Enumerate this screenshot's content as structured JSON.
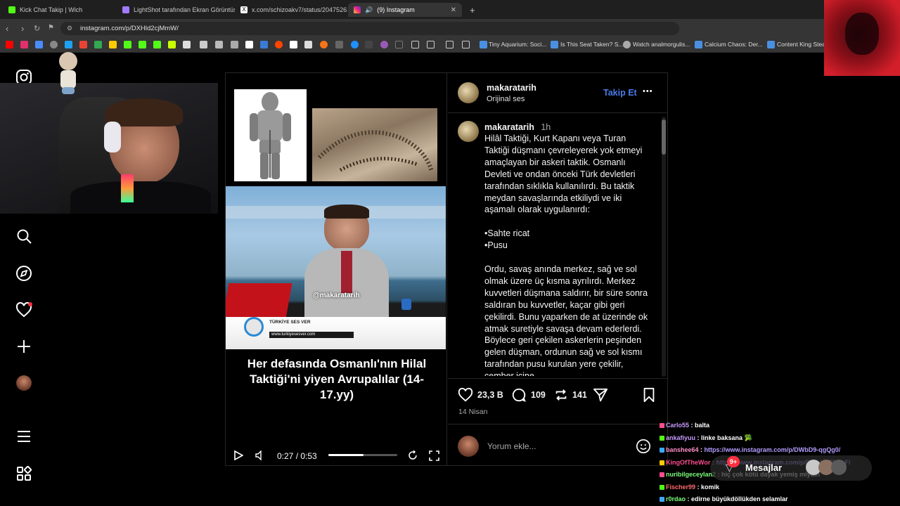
{
  "tabs": [
    {
      "title": "Kick Chat Takip | Wich",
      "icon_color": "#53fc18"
    },
    {
      "title": "LightShot tarafından Ekran Görüntüs",
      "icon_color": "#a17bff"
    },
    {
      "title": "x.com/schizoakv7/status/2047526374",
      "icon_color": "#ffffff"
    },
    {
      "title": "(9) Instagram",
      "icon_color": "#e1306c"
    }
  ],
  "address": {
    "url": "instagram.com/p/DXHld2cjMmW/"
  },
  "bookmarks": [
    {
      "label": "Tiny Aquarium: Soci..."
    },
    {
      "label": "Is This Seat Taken? S..."
    },
    {
      "label": "Watch analmorgulis..."
    },
    {
      "label": "Calcium Chaos: Der..."
    },
    {
      "label": "Content King Steam"
    }
  ],
  "post": {
    "username": "makaratarih",
    "audio": "Orijinal ses",
    "follow_label": "Takip Et",
    "more_label": "•••",
    "caption_user": "makaratarih",
    "time": "1h",
    "caption": "Hilâl Taktiği, Kurt Kapanı veya Turan Taktiği düşmanı çevreleyerek yok etmeyi amaçlayan bir askeri taktik. Osmanlı Devleti ve ondan önceki Türk devletleri tarafından sıklıkla kullanılırdı. Bu taktik meydan savaşlarında etkiliydi ve iki aşamalı olarak uygulanırdı:\n\n•Sahte ricat\n•Pusu\n\nOrdu, savaş anında merkez, sağ ve sol olmak üzere üç kısma ayrılırdı. Merkez kuvvetleri düşmana saldırır, bir süre sonra saldıran bu kuvvetler, kaçar gibi geri çekilirdi. Bunu yaparken de at üzerinde ok atmak suretiyle savaşa devam ederlerdi. Böylece geri çekilen askerlerin peşinden gelen düşman, ordunun sağ ve sol kısmı tarafından pusu kurulan yere çekilir, çember içine",
    "likes": "23,3 B",
    "comments": "109",
    "reposts": "141",
    "date": "14 Nisan",
    "comment_placeholder": "Yorum ekle..."
  },
  "video": {
    "watermark": "@makaratarih",
    "ticker_brand": "TÜRKİYE SES VER",
    "ticker_url": "www.turkiyesesver.com",
    "caption": "Her defasında Osmanlı'nın Hilal Taktiği'ni yiyen Avrupalılar (14-17.yy)",
    "time": "0:27 / 0:53",
    "progress": 0.51
  },
  "chat": [
    {
      "user": "Carlo55",
      "msg": "balta",
      "color": "#c79bff"
    },
    {
      "user": "ankafiyuu",
      "msg": "linke baksana 🥦",
      "color": "#c79bff"
    },
    {
      "user": "banshee64",
      "msg": "https://www.instagram.com/p/DWbD9-qgQg0/",
      "color": "#ff8fc7",
      "link": true
    },
    {
      "user": "KingOfTheWor",
      "msg": "https://www.instagram.com/p/DWbHyZDAkF/",
      "color": "#ff4d8d",
      "link": true
    },
    {
      "user": "nuribilgeceylan2",
      "msg": "hiç çok kötü dayak yemiş miydin",
      "color": "#7cff7c"
    },
    {
      "user": "Fischer99",
      "msg": "komik",
      "color": "#ff6b6b"
    },
    {
      "user": "r0rdao",
      "msg": "edirne büyükdöllükden selamlar",
      "color": "#7cff7c"
    }
  ],
  "overlay": {
    "messages_label": "Mesajlar",
    "notif_count": "9+"
  },
  "colors": {
    "accent": "#0095f6",
    "bg": "#000000"
  }
}
